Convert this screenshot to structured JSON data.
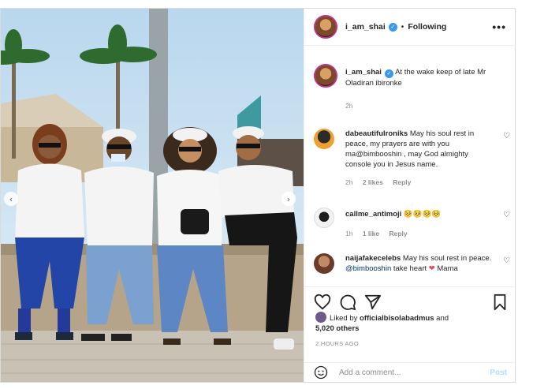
{
  "post": {
    "username": "i_am_shai",
    "follow_state": "Following",
    "more_label": "•••",
    "caption": "At the wake keep of late Mr Oladiran ibironke",
    "caption_time": "2h"
  },
  "comments": [
    {
      "username": "dabeautifulroniks",
      "text_before": "May his soul rest in peace, my prayers are with you ma@bimbooshin , may God almighty console you in Jesus name.",
      "time": "2h",
      "likes": "2 likes",
      "reply": "Reply"
    },
    {
      "username": "callme_antimoji",
      "text_before": "🥺🥺🥺🥺",
      "time": "1h",
      "likes": "1 like",
      "reply": "Reply"
    },
    {
      "username": "naijafakecelebs",
      "text_before": "May his soul rest in peace.",
      "mention": "@bimbooshin",
      "text_after": "take heart",
      "heart": "❤",
      "extra": "Mama"
    }
  ],
  "likes": {
    "prefix": "Liked by",
    "user": "officialbisolabadmus",
    "and": "and",
    "count": "5,020 others"
  },
  "timestamp": "2 HOURS AGO",
  "add_comment": {
    "placeholder": "Add a comment...",
    "post_label": "Post"
  },
  "icons": {
    "heart": "heart-icon",
    "comment": "comment-icon",
    "share": "share-icon",
    "save": "bookmark-icon",
    "emoji": "emoji-icon"
  },
  "colors": {
    "verified": "#3897f0",
    "link": "#00376b",
    "post_disabled": "#b2dffc",
    "story_ring": "#c13584"
  }
}
